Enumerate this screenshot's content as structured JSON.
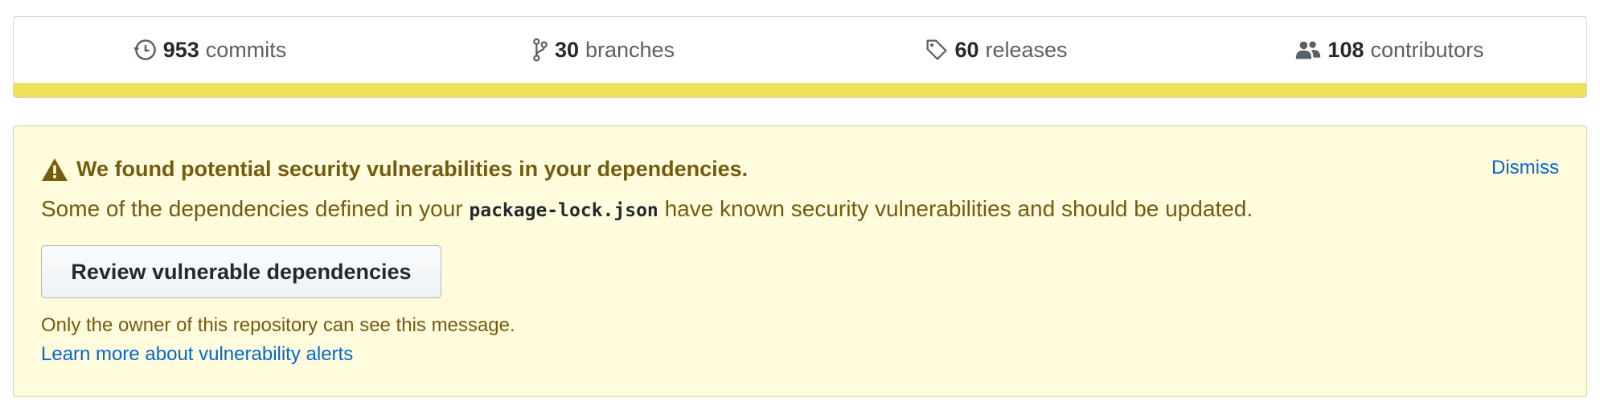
{
  "colors": {
    "language_bar": "#f1e05a",
    "alert_background": "#fffbdd",
    "alert_border": "#d9d0a5",
    "alert_text": "#735c0f",
    "link": "#0366d6"
  },
  "summary": {
    "commits": {
      "count": "953",
      "label": "commits",
      "icon": "history-icon"
    },
    "branches": {
      "count": "30",
      "label": "branches",
      "icon": "git-branch-icon"
    },
    "releases": {
      "count": "60",
      "label": "releases",
      "icon": "tag-icon"
    },
    "contributors": {
      "count": "108",
      "label": "contributors",
      "icon": "people-icon"
    }
  },
  "alert": {
    "icon": "alert-icon",
    "title": "We found potential security vulnerabilities in your dependencies.",
    "dismiss_label": "Dismiss",
    "body_before": "Some of the dependencies defined in your",
    "body_file": "package-lock.json",
    "body_after": "have known security vulnerabilities and should be updated.",
    "review_button_label": "Review vulnerable dependencies",
    "owner_note": "Only the owner of this repository can see this message.",
    "learn_more_label": "Learn more about vulnerability alerts"
  }
}
